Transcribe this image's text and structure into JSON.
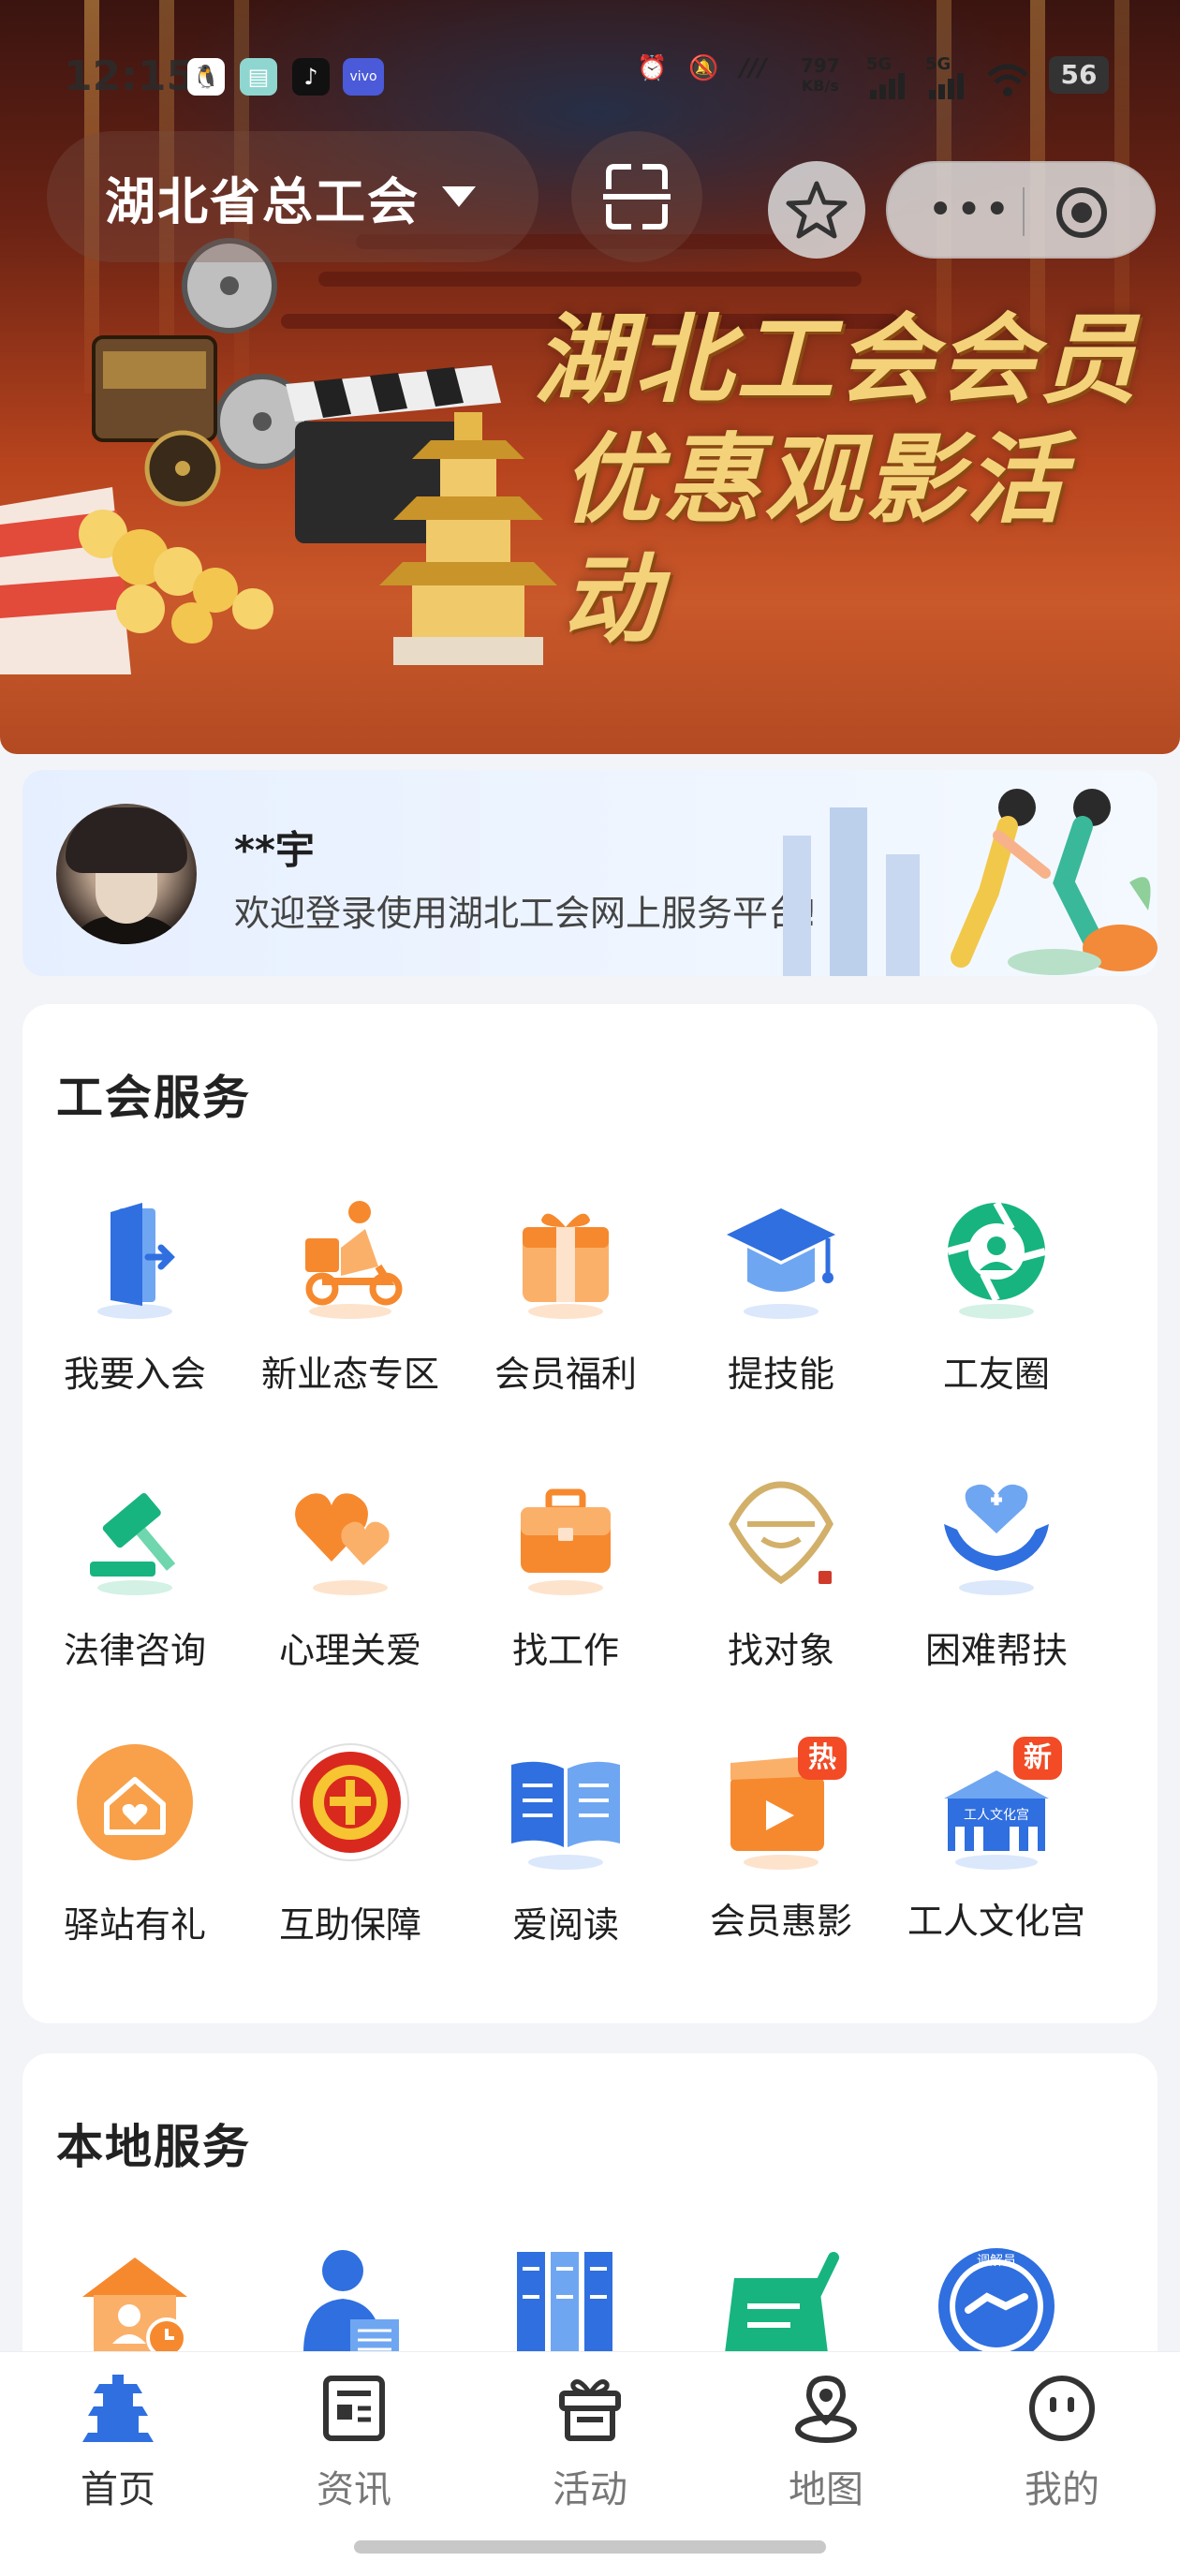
{
  "status_bar": {
    "time": "12:15",
    "speed_value": "797",
    "speed_unit": "KB/s",
    "net1": "5G",
    "net2": "5G",
    "battery": "56"
  },
  "header": {
    "union_name": "湖北省总工会"
  },
  "banner": {
    "line1": "湖北工会会员",
    "line2": "优惠观影活动"
  },
  "welcome": {
    "name": "**宇",
    "message": "欢迎登录使用湖北工会网上服务平台!"
  },
  "union_services": {
    "title": "工会服务",
    "items": [
      {
        "label": "我要入会",
        "icon": "door-icon"
      },
      {
        "label": "新业态专区",
        "icon": "delivery-scooter-icon"
      },
      {
        "label": "会员福利",
        "icon": "gift-box-icon"
      },
      {
        "label": "提技能",
        "icon": "graduation-cap-icon"
      },
      {
        "label": "工友圈",
        "icon": "camera-aperture-icon"
      },
      {
        "label": "法律咨询",
        "icon": "gavel-icon"
      },
      {
        "label": "心理关爱",
        "icon": "hearts-icon"
      },
      {
        "label": "找工作",
        "icon": "briefcase-icon"
      },
      {
        "label": "找对象",
        "icon": "matchmaking-logo-icon"
      },
      {
        "label": "困难帮扶",
        "icon": "helping-hands-icon"
      },
      {
        "label": "驿站有礼",
        "icon": "house-heart-icon"
      },
      {
        "label": "互助保障",
        "icon": "union-emblem-icon"
      },
      {
        "label": "爱阅读",
        "icon": "open-book-icon"
      },
      {
        "label": "会员惠影",
        "icon": "film-clapper-icon",
        "badge": "热"
      },
      {
        "label": "工人文化宫",
        "icon": "culture-palace-icon",
        "badge": "新",
        "sign": "工人文化宫"
      }
    ]
  },
  "local_services": {
    "title": "本地服务",
    "items": [
      {
        "icon": "house-clock-icon"
      },
      {
        "icon": "person-reading-icon"
      },
      {
        "icon": "bookshelf-icon"
      },
      {
        "icon": "sign-document-icon"
      },
      {
        "icon": "mediator-badge-icon",
        "text": "调解员"
      }
    ]
  },
  "bottom_nav": [
    {
      "label": "首页",
      "icon": "home-tower-icon",
      "active": true
    },
    {
      "label": "资讯",
      "icon": "news-icon",
      "active": false
    },
    {
      "label": "活动",
      "icon": "gift-icon",
      "active": false
    },
    {
      "label": "地图",
      "icon": "map-pin-icon",
      "active": false
    },
    {
      "label": "我的",
      "icon": "smiley-icon",
      "active": false
    }
  ],
  "colors": {
    "accent_blue": "#2f6fe0",
    "orange": "#f6892e",
    "green": "#17b480",
    "badge_red": "#f24b25"
  }
}
